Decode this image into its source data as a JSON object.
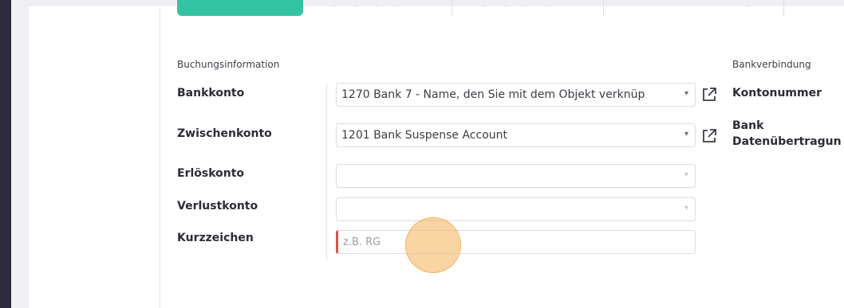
{
  "sections": {
    "booking_title": "Buchungsinformation",
    "bank_title": "Bankverbindung"
  },
  "fields": {
    "bankkonto": {
      "label": "Bankkonto",
      "value": "1270 Bank 7 - Name, den Sie mit dem Objekt verknüp"
    },
    "zwischenkonto": {
      "label": "Zwischenkonto",
      "value": "1201 Bank Suspense Account"
    },
    "erloeskonto": {
      "label": "Erlöskonto",
      "value": ""
    },
    "verlustkonto": {
      "label": "Verlustkonto",
      "value": ""
    },
    "kurzzeichen": {
      "label": "Kurzzeichen",
      "placeholder": "z.B. RG"
    }
  },
  "bank": {
    "kontonummer_label": "Kontonummer",
    "bank_label": "Bank",
    "datenuebertragung_label": "Datenübertragun"
  },
  "colors": {
    "accent": "#34c3a2",
    "required": "#d9534f",
    "sidebar": "#2d2a3c",
    "click_indicator": "#f5b25a"
  },
  "icons": [
    "external-link-icon",
    "chevron-down-icon"
  ]
}
